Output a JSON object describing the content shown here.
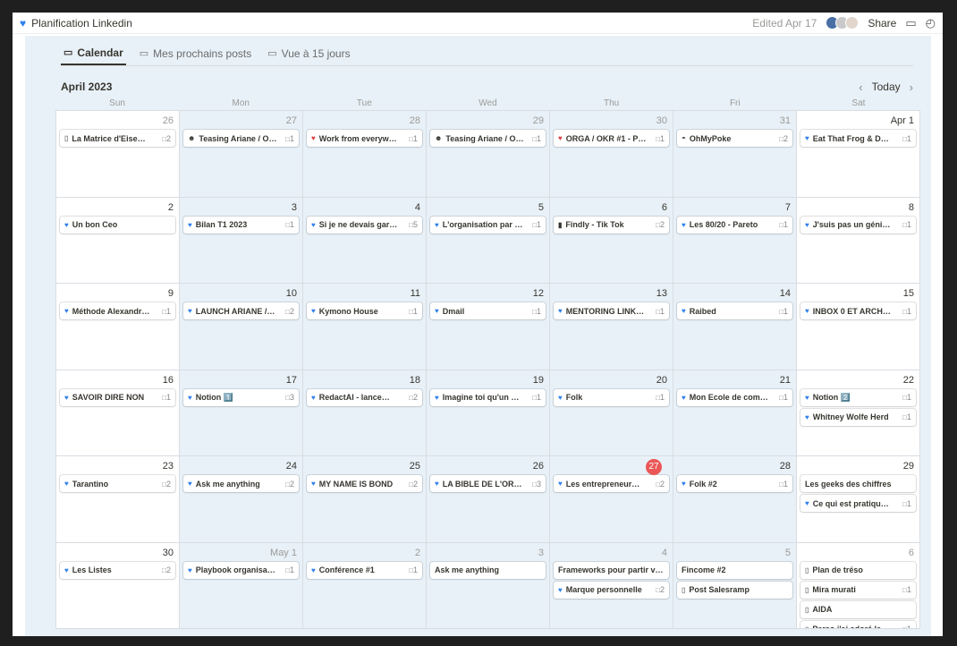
{
  "window": {
    "title": "Planification Linkedin",
    "edited": "Edited Apr 17",
    "share": "Share"
  },
  "tabs": [
    {
      "label": "Calendar",
      "icon": "calendar-icon",
      "active": true
    },
    {
      "label": "Mes prochains posts",
      "icon": "table-icon",
      "active": false
    },
    {
      "label": "Vue à 15 jours",
      "icon": "table-icon",
      "active": false
    }
  ],
  "month": {
    "label": "April 2023",
    "today": "Today"
  },
  "weekdays": [
    "Sun",
    "Mon",
    "Tue",
    "Wed",
    "Thu",
    "Fri",
    "Sat"
  ],
  "weeks": [
    [
      {
        "day": "26",
        "muted": true,
        "white": true,
        "items": [
          {
            "icon": "page",
            "title": "La Matrice d'Eise…",
            "count": "2"
          }
        ]
      },
      {
        "day": "27",
        "muted": true,
        "items": [
          {
            "icon": "grin",
            "title": "Teasing Ariane / O…",
            "count": "1"
          }
        ]
      },
      {
        "day": "28",
        "muted": true,
        "items": [
          {
            "icon": "red-heart",
            "title": "Work from everyw…",
            "count": "1"
          }
        ]
      },
      {
        "day": "29",
        "muted": true,
        "items": [
          {
            "icon": "grin",
            "title": "Teasing Ariane / O…",
            "count": "1"
          }
        ]
      },
      {
        "day": "30",
        "muted": true,
        "items": [
          {
            "icon": "red-heart",
            "title": "ORGA / OKR #1 - P…",
            "count": "1"
          }
        ]
      },
      {
        "day": "31",
        "muted": true,
        "items": [
          {
            "icon": "money-bag",
            "title": "OhMyPoke",
            "count": "2"
          }
        ]
      },
      {
        "day": "Apr 1",
        "white": true,
        "items": [
          {
            "icon": "blue-heart",
            "title": "Eat That Frog & D…",
            "count": "1"
          }
        ]
      }
    ],
    [
      {
        "day": "2",
        "white": true,
        "items": [
          {
            "icon": "blue-heart",
            "title": "Un bon Ceo",
            "count": ""
          }
        ]
      },
      {
        "day": "3",
        "items": [
          {
            "icon": "blue-heart",
            "title": "Bilan T1 2023",
            "count": "1"
          }
        ]
      },
      {
        "day": "4",
        "items": [
          {
            "icon": "blue-heart",
            "title": "Si je ne devais gar…",
            "count": "5"
          }
        ]
      },
      {
        "day": "5",
        "items": [
          {
            "icon": "blue-heart",
            "title": "L'organisation par …",
            "count": "1"
          }
        ]
      },
      {
        "day": "6",
        "items": [
          {
            "icon": "mobile",
            "title": "Findly - Tik Tok",
            "count": "2"
          }
        ]
      },
      {
        "day": "7",
        "items": [
          {
            "icon": "blue-heart",
            "title": "Les 80/20 - Pareto",
            "count": "1"
          }
        ]
      },
      {
        "day": "8",
        "white": true,
        "items": [
          {
            "icon": "blue-heart",
            "title": "J'suis pas un géni…",
            "count": "1"
          }
        ]
      }
    ],
    [
      {
        "day": "9",
        "white": true,
        "items": [
          {
            "icon": "blue-heart",
            "title": "Méthode Alexandr…",
            "count": "1"
          }
        ]
      },
      {
        "day": "10",
        "items": [
          {
            "icon": "blue-heart",
            "title": "LAUNCH ARIANE /…",
            "count": "2"
          }
        ]
      },
      {
        "day": "11",
        "items": [
          {
            "icon": "blue-heart",
            "title": "Kymono House",
            "count": "1"
          }
        ]
      },
      {
        "day": "12",
        "items": [
          {
            "icon": "blue-heart",
            "title": "Dmail",
            "count": "1"
          }
        ]
      },
      {
        "day": "13",
        "items": [
          {
            "icon": "blue-heart",
            "title": "MENTORING LINK…",
            "count": "1"
          }
        ]
      },
      {
        "day": "14",
        "items": [
          {
            "icon": "blue-heart",
            "title": "Raibed",
            "count": "1"
          }
        ]
      },
      {
        "day": "15",
        "white": true,
        "items": [
          {
            "icon": "blue-heart",
            "title": "INBOX 0 ET ARCH…",
            "count": "1"
          }
        ]
      }
    ],
    [
      {
        "day": "16",
        "white": true,
        "items": [
          {
            "icon": "blue-heart",
            "title": "SAVOIR DIRE NON",
            "count": "1"
          }
        ]
      },
      {
        "day": "17",
        "items": [
          {
            "icon": "blue-heart",
            "title": "Notion 1️⃣",
            "count": "3"
          }
        ]
      },
      {
        "day": "18",
        "items": [
          {
            "icon": "blue-heart",
            "title": "RedactAI - lance…",
            "count": "2"
          }
        ]
      },
      {
        "day": "19",
        "items": [
          {
            "icon": "blue-heart",
            "title": "Imagine toi qu'un …",
            "count": "1"
          }
        ]
      },
      {
        "day": "20",
        "items": [
          {
            "icon": "blue-heart",
            "title": "Folk",
            "count": "1"
          }
        ]
      },
      {
        "day": "21",
        "items": [
          {
            "icon": "blue-heart",
            "title": "Mon Ecole de com…",
            "count": "1"
          }
        ]
      },
      {
        "day": "22",
        "white": true,
        "items": [
          {
            "icon": "blue-heart",
            "title": "Notion 2️⃣",
            "count": "1"
          },
          {
            "icon": "blue-heart",
            "title": "Whitney Wolfe Herd",
            "count": "1"
          }
        ]
      }
    ],
    [
      {
        "day": "23",
        "white": true,
        "items": [
          {
            "icon": "blue-heart",
            "title": "Tarantino",
            "count": "2"
          }
        ]
      },
      {
        "day": "24",
        "items": [
          {
            "icon": "blue-heart",
            "title": "Ask me anything",
            "count": "2"
          }
        ]
      },
      {
        "day": "25",
        "items": [
          {
            "icon": "blue-heart",
            "title": "MY NAME IS BOND",
            "count": "2"
          }
        ]
      },
      {
        "day": "26",
        "items": [
          {
            "icon": "blue-heart",
            "title": "LA BIBLE DE L'OR…",
            "count": "3"
          }
        ]
      },
      {
        "day": "27",
        "today": true,
        "items": [
          {
            "icon": "blue-heart",
            "title": "Les entrepreneur…",
            "count": "2"
          }
        ]
      },
      {
        "day": "28",
        "items": [
          {
            "icon": "blue-heart",
            "title": "Folk #2",
            "count": "1"
          }
        ]
      },
      {
        "day": "29",
        "white": true,
        "items": [
          {
            "icon": "",
            "title": "Les geeks des chiffres",
            "count": ""
          },
          {
            "icon": "blue-heart",
            "title": "Ce qui est pratiqu…",
            "count": "1"
          }
        ]
      }
    ],
    [
      {
        "day": "30",
        "white": true,
        "items": [
          {
            "icon": "blue-heart",
            "title": "Les Listes",
            "count": "2"
          }
        ]
      },
      {
        "day": "May 1",
        "muted": true,
        "items": [
          {
            "icon": "blue-heart",
            "title": "Playbook organisa…",
            "count": "1"
          }
        ]
      },
      {
        "day": "2",
        "muted": true,
        "items": [
          {
            "icon": "blue-heart",
            "title": "Conférence #1",
            "count": "1"
          }
        ]
      },
      {
        "day": "3",
        "muted": true,
        "items": [
          {
            "icon": "",
            "title": "Ask me anything",
            "count": ""
          }
        ]
      },
      {
        "day": "4",
        "muted": true,
        "items": [
          {
            "icon": "",
            "title": "Frameworks pour partir v…",
            "count": ""
          },
          {
            "icon": "blue-heart",
            "title": "Marque personnelle",
            "count": "2"
          }
        ]
      },
      {
        "day": "5",
        "muted": true,
        "items": [
          {
            "icon": "",
            "title": "Fincome #2",
            "count": ""
          },
          {
            "icon": "page",
            "title": "Post Salesramp",
            "count": ""
          }
        ]
      },
      {
        "day": "6",
        "muted": true,
        "white": true,
        "items": [
          {
            "icon": "page",
            "title": "Plan de tréso",
            "count": ""
          },
          {
            "icon": "page",
            "title": "Mira murati",
            "count": "1"
          },
          {
            "icon": "page",
            "title": "AIDA",
            "count": ""
          },
          {
            "icon": "page",
            "title": "Perso j'ai adoré le …",
            "count": "1"
          }
        ]
      }
    ]
  ],
  "colors": {
    "accent_blue": "#2f80ed",
    "today_red": "#eb5757",
    "page_bg": "#e8f1f8"
  }
}
